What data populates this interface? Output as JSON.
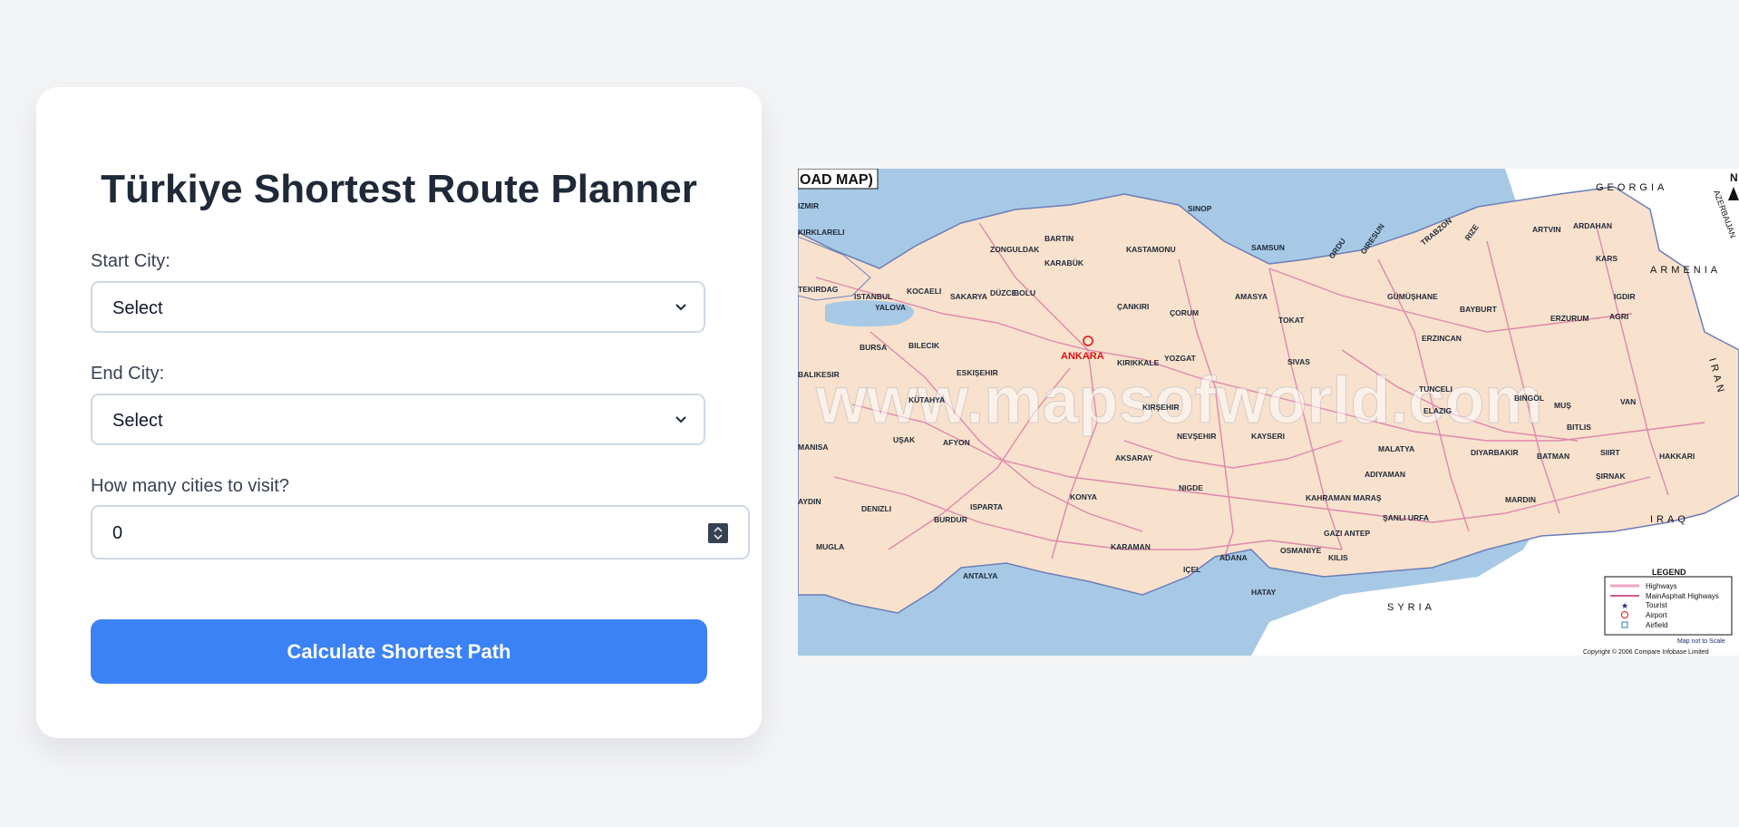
{
  "planner": {
    "title": "Türkiye Shortest Route Planner",
    "start_label": "Start City:",
    "start_value": "Select",
    "end_label": "End City:",
    "end_value": "Select",
    "count_label": "How many cities to visit?",
    "count_value": "0",
    "calculate_label": "Calculate Shortest Path"
  },
  "colors": {
    "accent": "#3b82f6",
    "page_bg": "#f3f4f6",
    "card_bg": "#ffffff"
  },
  "map": {
    "header": "OAD MAP)",
    "watermark": "www.mapsofworld.com",
    "countries": [
      "GEORGIA",
      "ARMENIA",
      "IRAN",
      "IRAQ",
      "SYRIA",
      "AZERBAIJAN"
    ],
    "north_label": "N",
    "capital": "ANKARA",
    "cities": [
      "SINOP",
      "BARTIN",
      "ZONGULDAK",
      "KASTAMONU",
      "SAMSUN",
      "ORDU",
      "GIRESUN",
      "TRABZON",
      "RIZE",
      "ARTVIN",
      "ARDAHAN",
      "KARS",
      "KIRKLARELI",
      "KARABÜK",
      "TEKIRDAG",
      "ISTANBUL",
      "KOCAELI",
      "SAKARYA",
      "DÜZCE",
      "BOLU",
      "YALOVA",
      "ÇANKIRI",
      "AMASYA",
      "ÇORUM",
      "TOKAT",
      "GÜMÜŞHANE",
      "BAYBURT",
      "IGDIR",
      "ERZURUM",
      "AGRI",
      "BURSA",
      "BILECIK",
      "ERZINCAN",
      "BALIKESIR",
      "KIRIKKALE",
      "YOZGAT",
      "SIVAS",
      "ESKIŞEHIR",
      "KÜTAHYA",
      "TUNCELI",
      "BINGÖL",
      "MUŞ",
      "VAN",
      "ELAZIG",
      "MANISA",
      "UŞAK",
      "AFYON",
      "NEVŞEHIR",
      "KAYSERI",
      "KIRŞEHIR",
      "MALATYA",
      "BITLIS",
      "SIIRT",
      "HAKKARI",
      "DIYARBAKIR",
      "BATMAN",
      "ŞIRNAK",
      "AKSARAY",
      "ADIYAMAN",
      "AYDIN",
      "DENIZLI",
      "ISPARTA",
      "KONYA",
      "NIGDE",
      "KAHRAMAN MARAŞ",
      "MARDIN",
      "BURDUR",
      "ŞANLI URFA",
      "MUGLA",
      "GAZI ANTEP",
      "KARAMAN",
      "OSMANIYE",
      "ADANA",
      "KILIS",
      "ANTALYA",
      "IÇEL",
      "HATAY",
      "IZMIR"
    ],
    "legend": {
      "title": "LEGEND",
      "items": [
        "Highways",
        "MainAsphalt Highways",
        "Tourist",
        "Airport",
        "Airfield"
      ]
    },
    "scale_note": "Map not to Scale",
    "copyright": "Copyright © 2006 Compare Infobase Limited"
  }
}
